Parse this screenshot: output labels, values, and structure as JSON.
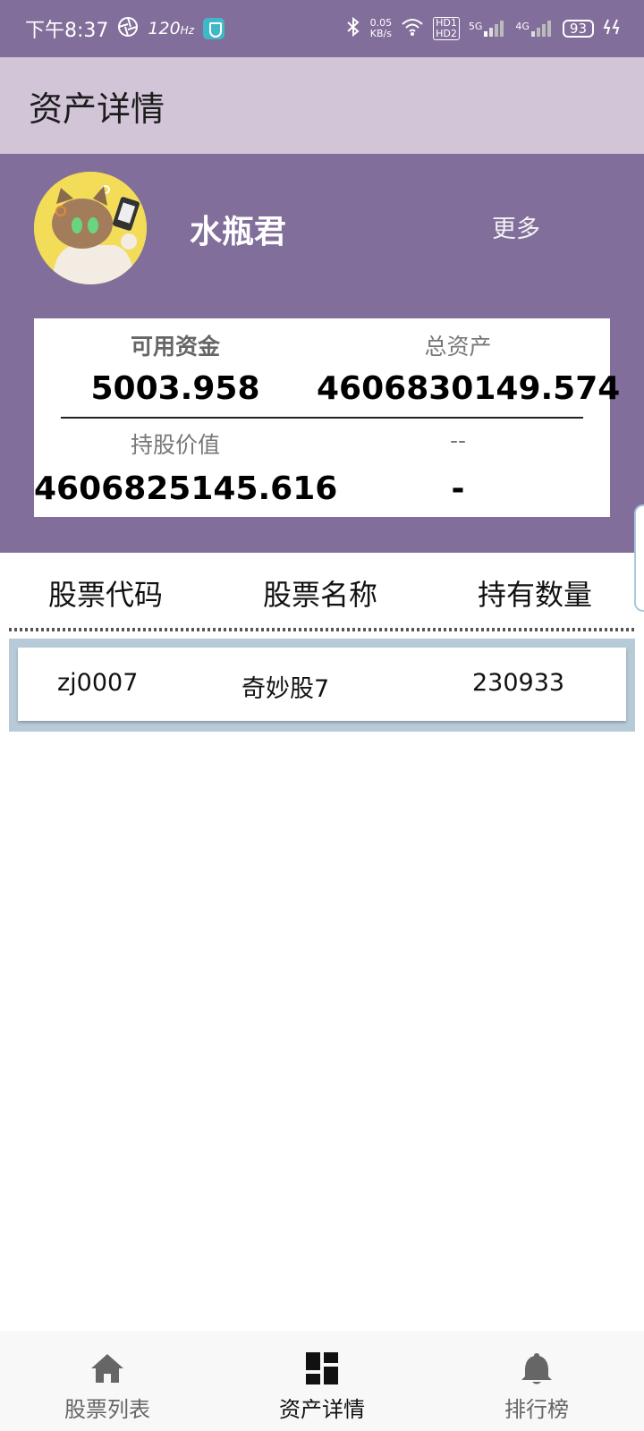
{
  "status_bar": {
    "time": "下午8:37",
    "refresh_rate": "120",
    "hz_unit": "Hz",
    "net_speed_value": "0.05",
    "net_speed_unit": "KB/s",
    "hd1": "HD1",
    "hd2": "HD2",
    "sig1": "5G",
    "sig2": "4G",
    "battery": "93"
  },
  "app_bar": {
    "title": "资产详情"
  },
  "profile": {
    "name": "水瓶君",
    "more_label": "更多"
  },
  "assets": {
    "available_label": "可用资金",
    "available_value": "5003.958",
    "total_label": "总资产",
    "total_value": "4606830149.574",
    "holding_label": "持股价值",
    "holding_value": "4606825145.616",
    "extra_label": "--",
    "extra_value": "-"
  },
  "table": {
    "headers": [
      "股票代码",
      "股票名称",
      "持有数量"
    ],
    "rows": [
      {
        "code": "zj0007",
        "name": "奇妙股7",
        "quantity": "230933"
      }
    ]
  },
  "bottom_nav": {
    "items": [
      {
        "label": "股票列表",
        "icon": "home-icon"
      },
      {
        "label": "资产详情",
        "icon": "dashboard-icon"
      },
      {
        "label": "排行榜",
        "icon": "bell-icon"
      }
    ],
    "active_index": 1
  },
  "colors": {
    "header_purple": "#826e9b",
    "app_bar_lilac": "#d2c5d8",
    "row_border_blue": "#b7cad7"
  }
}
